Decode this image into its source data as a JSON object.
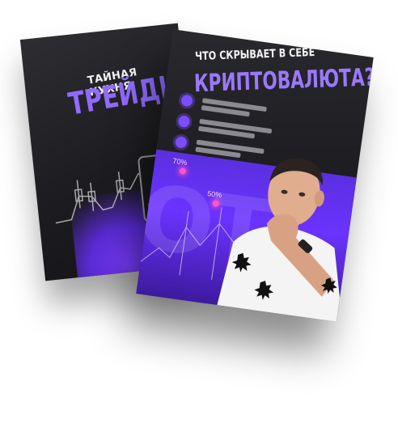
{
  "back_poster": {
    "subtitle": "ТАЙНАЯ КУХНЯ",
    "title": "ТРЕЙДИНГА"
  },
  "front_poster": {
    "subtitle": "ЧТО СКРЫВАЕТ В СЕБЕ",
    "title": "КРИПТОВАЛЮТА?",
    "percent_high": "70%",
    "percent_low": "50%"
  },
  "colors": {
    "accent_purple": "#8f6bff",
    "band_purple": "#6a33ff",
    "poster_dark": "#1d1c20",
    "marker_pink": "#ff55c8"
  }
}
